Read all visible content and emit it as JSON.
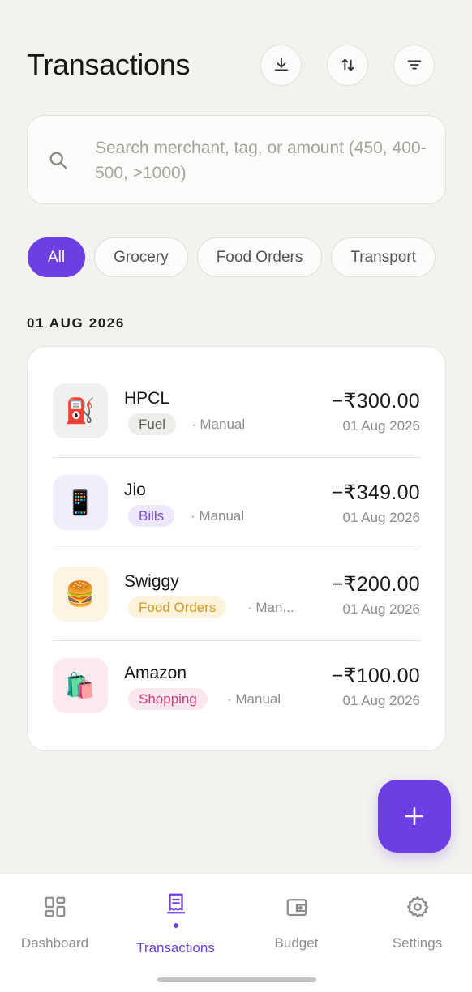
{
  "header": {
    "title": "Transactions"
  },
  "header_actions": [
    {
      "icon": "download-icon"
    },
    {
      "icon": "sort-icon"
    },
    {
      "icon": "filter-icon"
    }
  ],
  "search": {
    "placeholder": "Search merchant, tag, or amount (450, 400-500, >1000)"
  },
  "chips": [
    {
      "label": "All",
      "active": true
    },
    {
      "label": "Grocery",
      "active": false
    },
    {
      "label": "Food Orders",
      "active": false
    },
    {
      "label": "Transport",
      "active": false
    }
  ],
  "sections": [
    {
      "date": "01 AUG 2026",
      "transactions": [
        {
          "merchant": "HPCL",
          "tag": "Fuel",
          "tag_color": "#5f5e5a",
          "tag_bg": "#eeedea",
          "source": "Manual",
          "amount": "−₹300.00",
          "date": "01 Aug 2026",
          "icon": "fuel-pump-icon",
          "emoji": "⛽",
          "avatar_bg": "#f1f0ee"
        },
        {
          "merchant": "Jio",
          "tag": "Bills",
          "tag_color": "#7c4fd9",
          "tag_bg": "#efe8fd",
          "source": "Manual",
          "amount": "−₹349.00",
          "date": "01 Aug 2026",
          "icon": "mobile-phone-icon",
          "emoji": "📱",
          "avatar_bg": "#f2edfd"
        },
        {
          "merchant": "Swiggy",
          "tag": "Food Orders",
          "tag_color": "#d99a1c",
          "tag_bg": "#fdf3dd",
          "source": "Man...",
          "amount": "−₹200.00",
          "date": "01 Aug 2026",
          "icon": "burger-icon",
          "emoji": "🍔",
          "avatar_bg": "#fdf4e4"
        },
        {
          "merchant": "Amazon",
          "tag": "Shopping",
          "tag_color": "#d43c7a",
          "tag_bg": "#fce6ef",
          "source": "Manual",
          "amount": "−₹100.00",
          "date": "01 Aug 2026",
          "icon": "shopping-bags-icon",
          "emoji": "🛍️",
          "avatar_bg": "#fce9f0"
        }
      ]
    }
  ],
  "fab": {
    "icon": "plus-icon"
  },
  "bottom_nav": [
    {
      "label": "Dashboard",
      "icon": "dashboard-icon",
      "active": false
    },
    {
      "label": "Transactions",
      "icon": "receipt-icon",
      "active": true
    },
    {
      "label": "Budget",
      "icon": "wallet-icon",
      "active": false
    },
    {
      "label": "Settings",
      "icon": "gear-icon",
      "active": false
    }
  ],
  "colors": {
    "accent": "#6b3fe3",
    "background": "#f3f2ef"
  }
}
